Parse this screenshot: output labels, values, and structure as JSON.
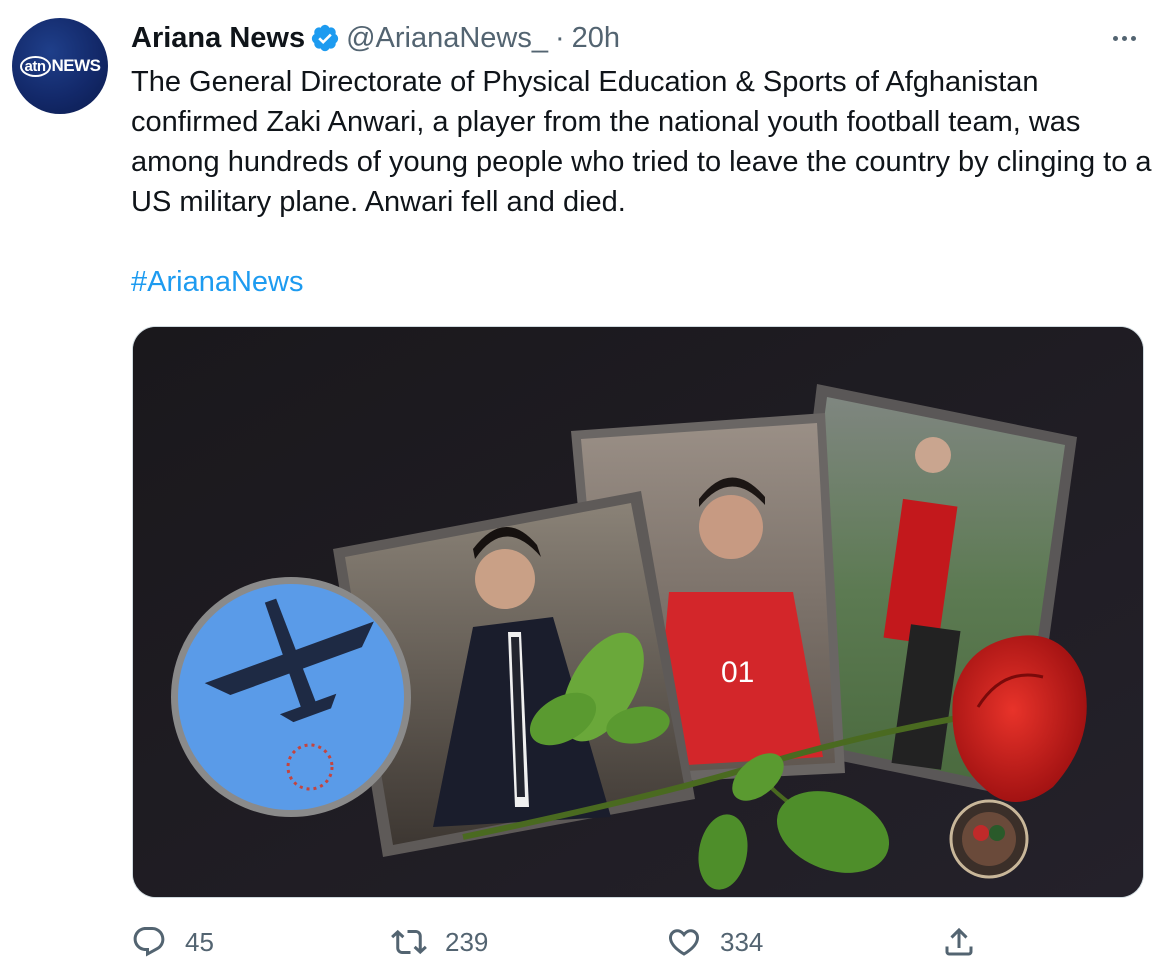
{
  "account": {
    "avatar_text": "atn",
    "avatar_text2": "NEWS",
    "display_name": "Ariana News",
    "handle": "@ArianaNews_",
    "separator": "·",
    "time": "20h",
    "verified": true
  },
  "tweet": {
    "text": "The General Directorate of Physical Education & Sports of Afghanistan confirmed Zaki Anwari, a player from the national youth football team, was among hundreds of young people who tried to leave the country by clinging to a US military plane. Anwari fell and died.",
    "hashtag": "#ArianaNews"
  },
  "media": {
    "alt_description_icons": [
      "plane-icon",
      "rose-icon",
      "emblem-icon"
    ]
  },
  "actions": {
    "reply_count": "45",
    "retweet_count": "239",
    "like_count": "334"
  },
  "colors": {
    "accent": "#1d9bf0",
    "secondary_text": "#536471",
    "primary_text": "#0f1419"
  }
}
